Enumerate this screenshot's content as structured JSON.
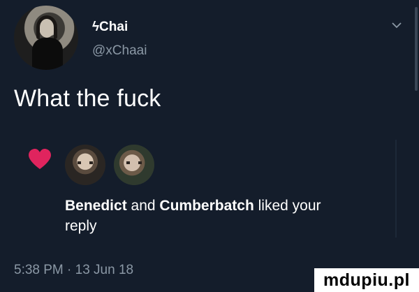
{
  "tweet": {
    "display_name": "ϟChai",
    "handle": "@xChaai",
    "text": "What the fuck",
    "timestamp": "5:38 PM · 13 Jun 18",
    "menu_icon": "chevron-down-icon",
    "avatar_icon": "user-avatar"
  },
  "likes": {
    "heart_color": "#e0245e",
    "name_one": "Benedict",
    "conjunction": "and",
    "name_two": "Cumberbatch",
    "rest_line1": "liked your",
    "rest_line2": "reply"
  },
  "watermark": {
    "text": "mdupiu.pl"
  },
  "colors": {
    "background": "#141d2b",
    "secondary_text": "#8b98a5",
    "primary_text": "#ffffff"
  }
}
